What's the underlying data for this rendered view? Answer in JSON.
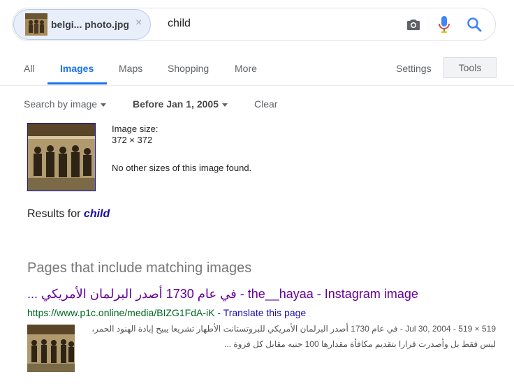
{
  "search": {
    "chip_label": "belgi... photo.jpg",
    "chip_close": "×",
    "query": "child"
  },
  "tabs": [
    "All",
    "Images",
    "Maps",
    "Shopping",
    "More"
  ],
  "settings_label": "Settings",
  "tools_label": "Tools",
  "filters": {
    "search_by": "Search by image",
    "date": "Before Jan 1, 2005",
    "clear": "Clear"
  },
  "image_info": {
    "size_label": "Image size:",
    "size_value": "372 × 372",
    "other_sizes": "No other sizes of this image found."
  },
  "results_for": {
    "prefix": "Results for ",
    "term": "child"
  },
  "section_title": "Pages that include matching images",
  "result": {
    "title": "... في عام 1730 أصدر البرلمان الأمريكي - the__hayaa - Instagram image",
    "url": "https://www.p1c.online/media/BIZG1FdA-iK",
    "translate": "Translate this page",
    "separator": " - ",
    "snippet_line1": "519 × 519 - Jul 30, 2004 - في عام 1730 أصدر البرلمان الأمريكي للبروتستانت الأطهار تشريعا يبيح إبادة الهنود الحمر،",
    "snippet_line2": "ليس فقط بل وأصدرت قرارا بتقديم مكافأة مقدارها 100 جنيه مقابل كل فروة ..."
  },
  "colors": {
    "accent": "#1a73e8",
    "link": "#1a0dab",
    "visited": "#660099",
    "url": "#006621"
  }
}
